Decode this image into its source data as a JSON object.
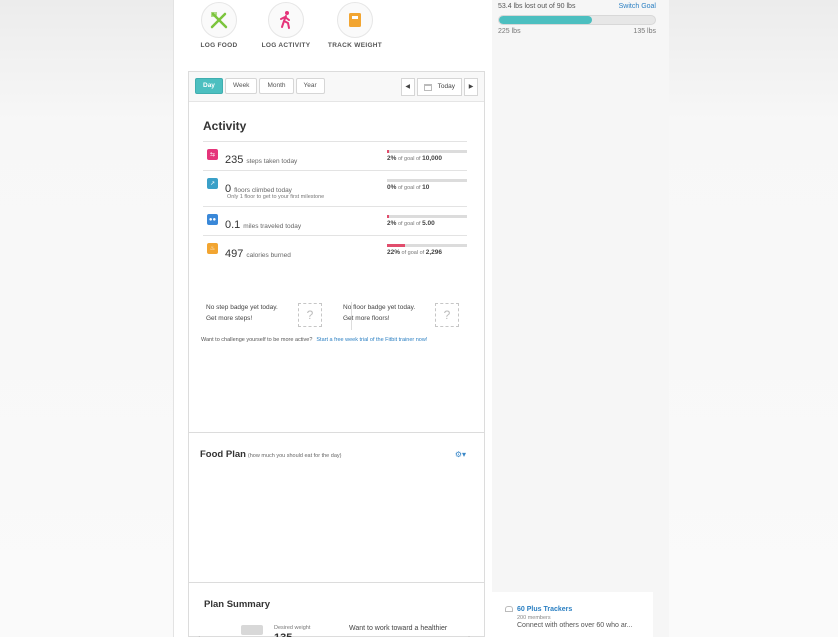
{
  "quick_actions": [
    {
      "label": "LOG FOOD",
      "icon": "fork-knife-icon",
      "color": "#7cc53d"
    },
    {
      "label": "LOG ACTIVITY",
      "icon": "walking-person-icon",
      "color": "#e5347a"
    },
    {
      "label": "TRACK WEIGHT",
      "icon": "scale-icon",
      "color": "#f2a531"
    }
  ],
  "weight_goal": {
    "summary": "53.4 lbs lost out of 90 lbs",
    "switch_label": "Switch Goal",
    "progress_fraction": 0.593,
    "start_label": "225 lbs",
    "goal_label": "135 lbs",
    "color": "#4cbfc0"
  },
  "toolbar": {
    "tabs": [
      "Day",
      "Week",
      "Month",
      "Year"
    ],
    "active_tab": "Day",
    "prev": "◀",
    "next": "▶",
    "today_label": "Today"
  },
  "activity": {
    "title": "Activity",
    "rows": [
      {
        "icon": "steps-icon",
        "color": "#e5347a",
        "value": "235",
        "unit": "steps taken today",
        "sub": "",
        "percent": "2%",
        "goal": "10,000",
        "fraction": 0.02
      },
      {
        "icon": "floors-icon",
        "color": "#3aa0c8",
        "value": "0",
        "unit": "floors climbed today",
        "sub": "Only 1 floor to get to your first milestone",
        "percent": "0%",
        "goal": "10",
        "fraction": 0.0
      },
      {
        "icon": "distance-icon",
        "color": "#3a88d8",
        "value": "0.1",
        "unit": "miles traveled today",
        "sub": "",
        "percent": "2%",
        "goal": "5.00",
        "fraction": 0.02
      },
      {
        "icon": "flame-icon",
        "color": "#f2a531",
        "value": "497",
        "unit": "calories burned",
        "sub": "",
        "percent": "22%",
        "goal": "2,296",
        "fraction": 0.22
      }
    ],
    "of_goal_of": "of goal of",
    "badges": {
      "step_text": "No step badge yet today.",
      "step_link": "Get more steps!",
      "floor_text": "No floor badge yet today.",
      "floor_link": "Get more floors!",
      "placeholder": "?"
    },
    "challenge_text": "Want to challenge yourself to be more active?",
    "challenge_link": "Start a free week trial of the Fitbit trainer now!"
  },
  "food_plan": {
    "title": "Food Plan",
    "subtitle": "(how much you should eat for the day)"
  },
  "plan_summary": {
    "title": "Plan Summary",
    "desired_label": "Desired weight",
    "desired_value": "135",
    "cta": "Want to work toward a healthier"
  },
  "group": {
    "name": "60 Plus Trackers",
    "members": "200 members",
    "desc": "Connect with others over 60 who ar..."
  }
}
